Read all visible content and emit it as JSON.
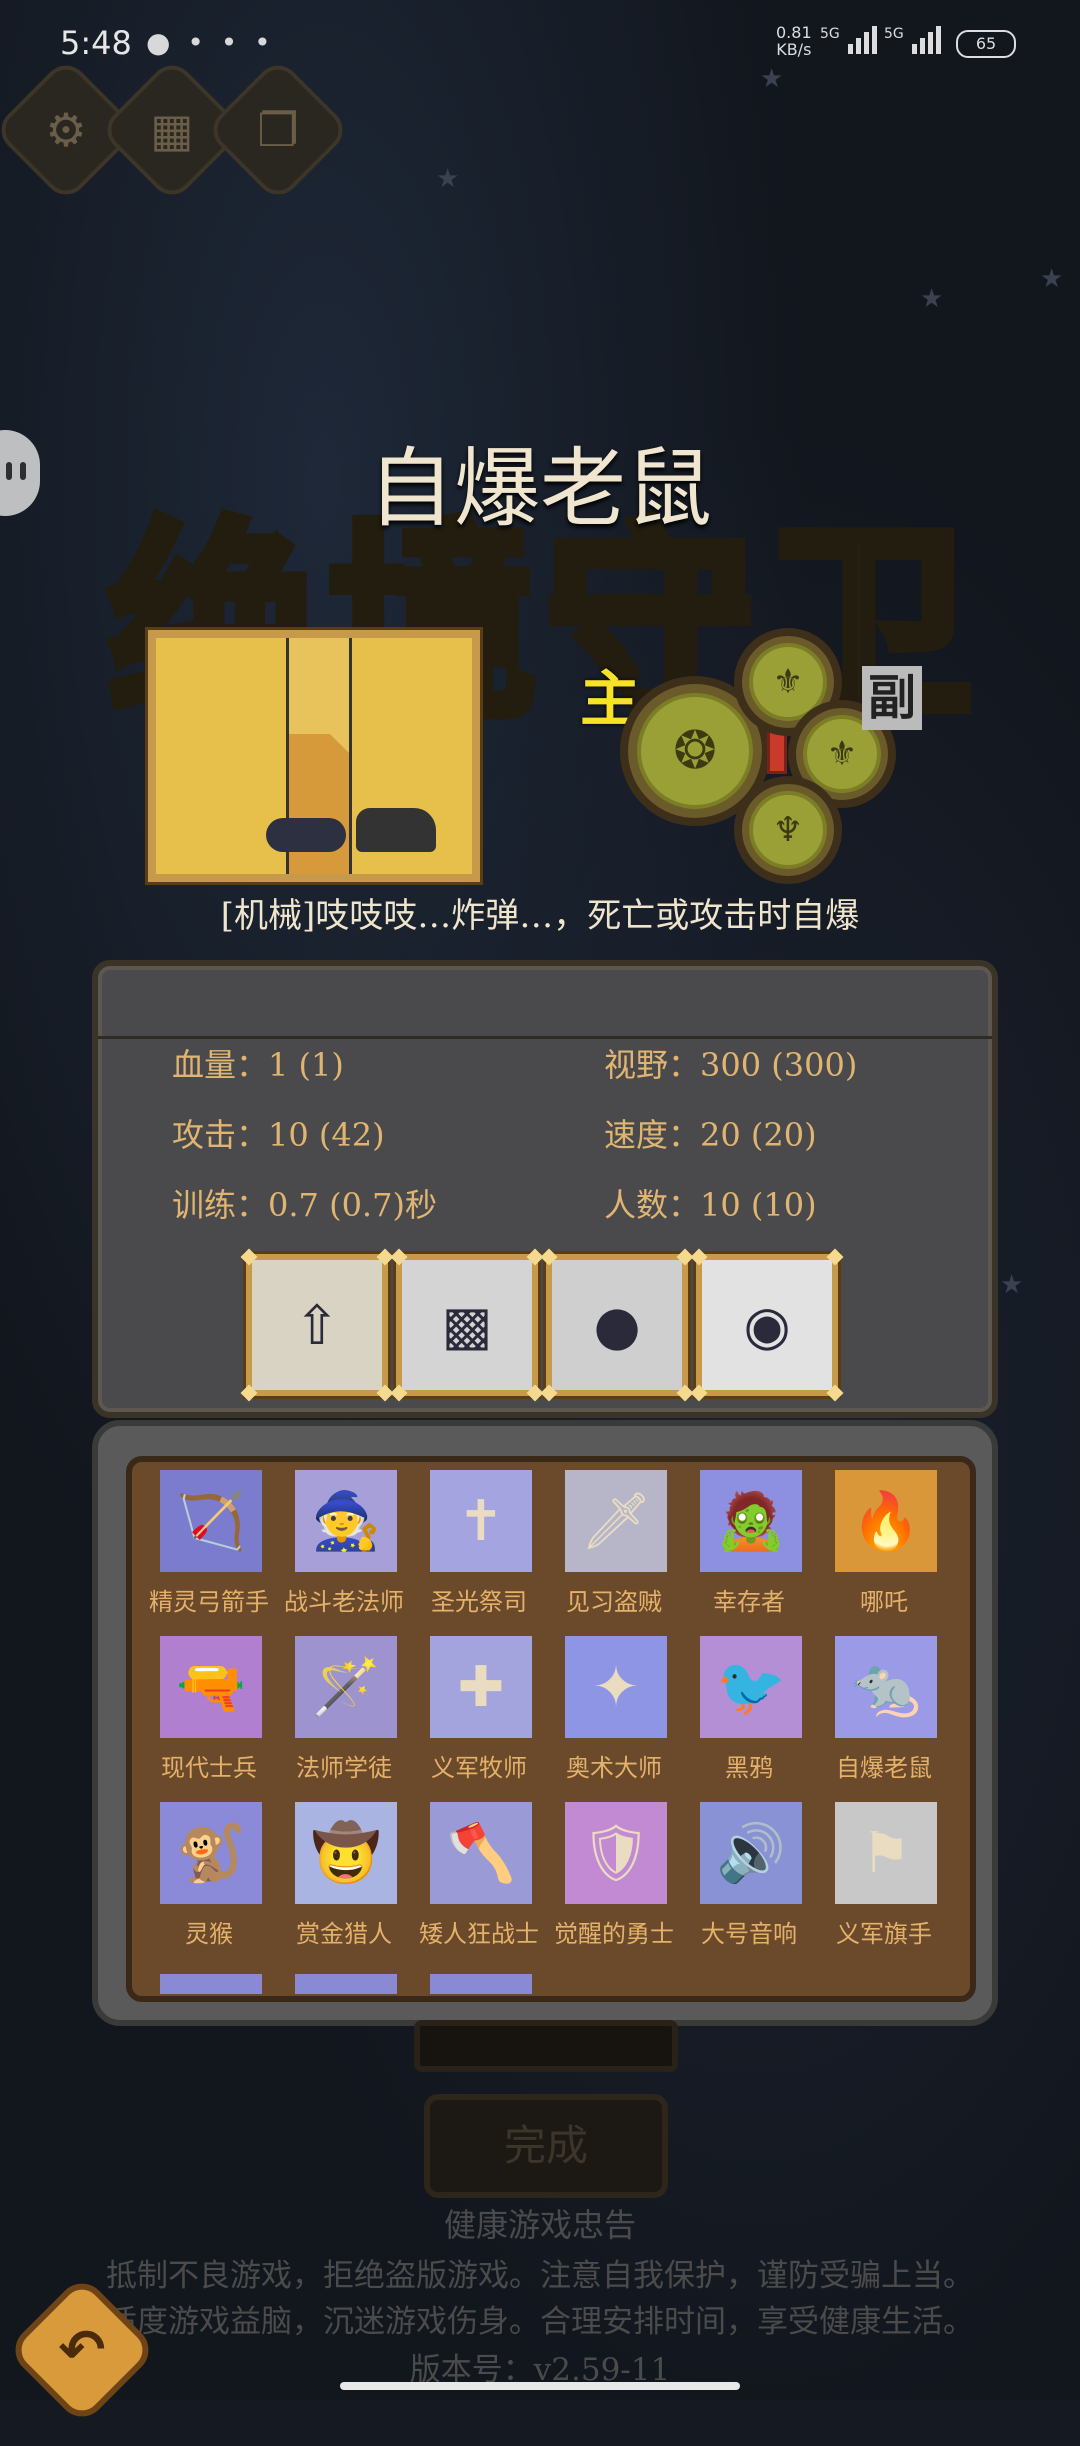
{
  "status_bar": {
    "time": "5:48",
    "icons": "● • • •",
    "net_speed": "0.81",
    "net_unit": "KB/s",
    "sig1": "5G",
    "sig2": "5G",
    "battery": "65"
  },
  "top_buttons": [
    {
      "icon": "gear-icon",
      "glyph": "⚙"
    },
    {
      "icon": "gift-icon",
      "glyph": "▦"
    },
    {
      "icon": "copy-icon",
      "glyph": "❐"
    }
  ],
  "background_title": "绝境守卫",
  "unit": {
    "name": "自爆老鼠",
    "main_label": "主",
    "sub_label": "副",
    "description": "[机械]吱吱吱…炸弹…，死亡或攻击时自爆"
  },
  "stats": {
    "hp_label": "血量：",
    "hp_value": "1 (1)",
    "vision_label": "视野：",
    "vision_value": "300 (300)",
    "attack_label": "攻击：",
    "attack_value": "10 (42)",
    "speed_label": "速度：",
    "speed_value": "20 (20)",
    "train_label": "训练：",
    "train_value": "0.7 (0.7)秒",
    "count_label": "人数：",
    "count_value": "10 (10)"
  },
  "skills": [
    {
      "icon": "upgrade-arrow-icon",
      "glyph": "⇧",
      "bg": "#d8d3c3"
    },
    {
      "icon": "rat-swarm-icon",
      "glyph": "▩",
      "bg": "#d4d4d4"
    },
    {
      "icon": "bomb-icon",
      "glyph": "●",
      "bg": "#cfcfcf"
    },
    {
      "icon": "rat-glow-icon",
      "glyph": "◉",
      "bg": "#e2e2e2"
    }
  ],
  "roster": [
    {
      "name": "精灵弓箭手",
      "bg": "#7c7ccf",
      "glyph": "🏹"
    },
    {
      "name": "战斗老法师",
      "bg": "#a7a0d8",
      "glyph": "🧙"
    },
    {
      "name": "圣光祭司",
      "bg": "#a4a4e0",
      "glyph": "✝"
    },
    {
      "name": "见习盗贼",
      "bg": "#b6b6c8",
      "glyph": "🗡"
    },
    {
      "name": "幸存者",
      "bg": "#8d8fe0",
      "glyph": "🧟"
    },
    {
      "name": "哪吒",
      "bg": "#d9973a",
      "glyph": "🔥"
    },
    {
      "name": "现代士兵",
      "bg": "#b07fd0",
      "glyph": "🔫"
    },
    {
      "name": "法师学徒",
      "bg": "#9c93cf",
      "glyph": "🪄"
    },
    {
      "name": "义军牧师",
      "bg": "#a3a3dd",
      "glyph": "✚"
    },
    {
      "name": "奥术大师",
      "bg": "#8d95e4",
      "glyph": "✦"
    },
    {
      "name": "黑鸦",
      "bg": "#b48fd6",
      "glyph": "🐦"
    },
    {
      "name": "自爆老鼠",
      "bg": "#9a9ae6",
      "glyph": "🐀"
    },
    {
      "name": "灵猴",
      "bg": "#8a8ad8",
      "glyph": "🐒"
    },
    {
      "name": "赏金猎人",
      "bg": "#a9b4e2",
      "glyph": "🤠"
    },
    {
      "name": "矮人狂战士",
      "bg": "#9a9ad6",
      "glyph": "🪓"
    },
    {
      "name": "觉醒的勇士",
      "bg": "#c38ad4",
      "glyph": "🛡"
    },
    {
      "name": "大号音响",
      "bg": "#8a92d6",
      "glyph": "🔊"
    },
    {
      "name": "义军旗手",
      "bg": "#c8c8c8",
      "glyph": "⚑"
    }
  ],
  "bottom": {
    "confirm_label": "完成",
    "notice_title": "健康游戏忠告",
    "notice_line1": "抵制不良游戏，拒绝盗版游戏。注意自我保护，谨防受骗上当。",
    "notice_line2": "适度游戏益脑，沉迷游戏伤身。合理安排时间，享受健康生活。",
    "version": "版本号：v2.59-11"
  }
}
